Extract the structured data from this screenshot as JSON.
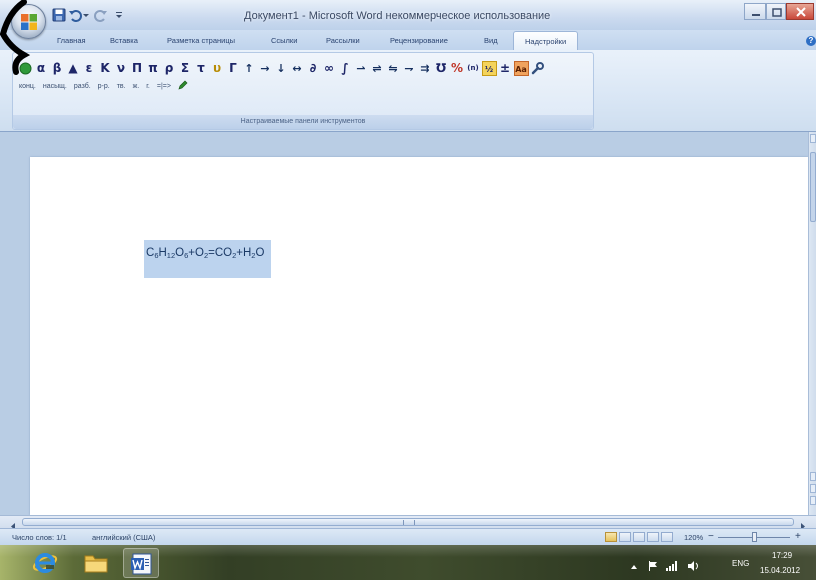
{
  "window": {
    "title": "Документ1 - Microsoft Word некоммерческое использование",
    "help_label": "?"
  },
  "quick_access": {
    "icons": [
      "save-icon",
      "undo-icon",
      "undo-dropdown-icon",
      "redo-icon",
      "customize-dropdown-icon"
    ]
  },
  "ribbon": {
    "tabs": [
      "Главная",
      "Вставка",
      "Разметка страницы",
      "Ссылки",
      "Рассылки",
      "Рецензирование",
      "Вид",
      "Надстройки"
    ],
    "active_tab_index": 7,
    "symbols": [
      "α",
      "β",
      "▲",
      "ε",
      "K",
      "ν",
      "Π",
      "π",
      "ρ",
      "Σ",
      "τ",
      "υ",
      "Γ",
      "↑",
      "→",
      "↓",
      "↔",
      "∂",
      "∞",
      "∫",
      "⇀",
      "⇌",
      "⇋",
      "⇁",
      "⇉",
      "℧",
      "%",
      "(n)",
      "½",
      "±",
      "Aa"
    ],
    "state_labels": [
      "конц.",
      "насыщ.",
      "разб.",
      "р-р.",
      "тв.",
      "ж.",
      "г.",
      "=|=>"
    ],
    "group_label": "Настраиваемые панели инструментов"
  },
  "document": {
    "formula": [
      {
        "base": "C",
        "sub": "6"
      },
      {
        "base": "H",
        "sub": "12"
      },
      {
        "base": "O",
        "sub": "6"
      },
      {
        "base": "+O",
        "sub": "2"
      },
      {
        "base": "=CO",
        "sub": "2"
      },
      {
        "base": "+H",
        "sub": "2"
      },
      {
        "base": "O",
        "sub": ""
      }
    ],
    "selected": true
  },
  "status_bar": {
    "word_count": "Число слов: 1/1",
    "language": "английский (США)",
    "zoom": "120%",
    "zoom_out": "−",
    "zoom_in": "+"
  },
  "taskbar": {
    "apps": [
      "internet-explorer-icon",
      "file-explorer-icon",
      "word-icon"
    ],
    "tray_language": "ENG",
    "time": "17:29",
    "date": "15.04.2012"
  },
  "colors": {
    "ribbon": "#dbe6f4",
    "workspace": "#b9cde4",
    "selection": "#bcd3ee",
    "close_button": "#c9483a",
    "taskbar": "#3f4c2d"
  }
}
